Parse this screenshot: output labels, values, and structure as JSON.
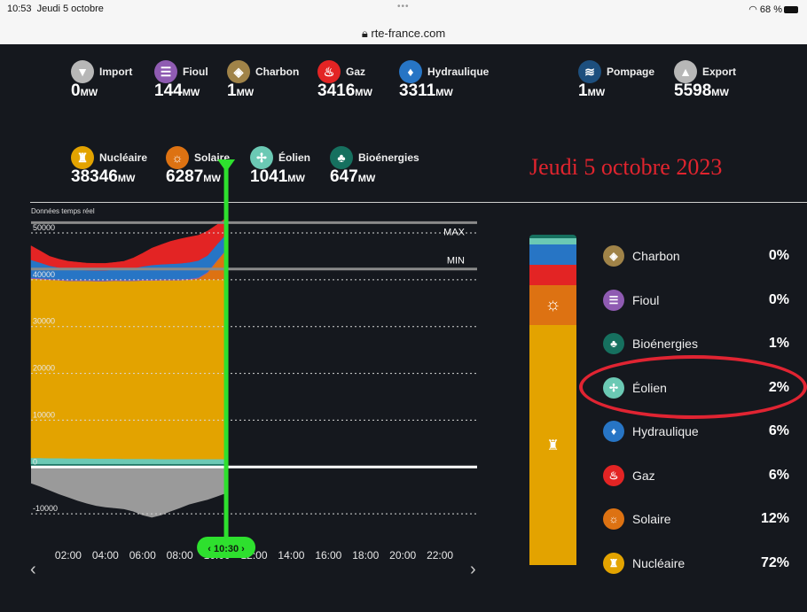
{
  "status_bar": {
    "time": "10:53",
    "date": "Jeudi 5 octobre",
    "url": "rte-france.com",
    "battery": "68 %"
  },
  "sources_top": [
    {
      "label": "Import",
      "value": "0",
      "unit": "MW",
      "icon": "chevron-down-icon",
      "color": "#b7b7b7"
    },
    {
      "label": "Fioul",
      "value": "144",
      "unit": "MW",
      "icon": "oil-barrel-icon",
      "color": "#8f5bb2"
    },
    {
      "label": "Charbon",
      "value": "1",
      "unit": "MW",
      "icon": "coal-icon",
      "color": "#a08348"
    },
    {
      "label": "Gaz",
      "value": "3416",
      "unit": "MW",
      "icon": "flame-icon",
      "color": "#e32424"
    },
    {
      "label": "Hydraulique",
      "value": "3311",
      "unit": "MW",
      "icon": "water-drop-icon",
      "color": "#2775c5"
    },
    {
      "label": "Pompage",
      "value": "1",
      "unit": "MW",
      "icon": "waves-icon",
      "color": "#1d4f7e"
    },
    {
      "label": "Export",
      "value": "5598",
      "unit": "MW",
      "icon": "chevron-up-icon",
      "color": "#b7b7b7"
    }
  ],
  "sources_bottom": [
    {
      "label": "Nucléaire",
      "value": "38346",
      "unit": "MW",
      "icon": "nuclear-plant-icon",
      "color": "#e3a300"
    },
    {
      "label": "Solaire",
      "value": "6287",
      "unit": "MW",
      "icon": "sun-icon",
      "color": "#dd7212"
    },
    {
      "label": "Éolien",
      "value": "1041",
      "unit": "MW",
      "icon": "wind-turbine-icon",
      "color": "#6bc9b4"
    },
    {
      "label": "Bioénergies",
      "value": "647",
      "unit": "MW",
      "icon": "sprout-icon",
      "color": "#16705f"
    }
  ],
  "date_title": "Jeudi 5 octobre 2023",
  "realtime_label": "Données temps réel",
  "chart_data": {
    "type": "area",
    "ylim": [
      -13000,
      57000
    ],
    "y_ticks": [
      -10000,
      0,
      10000,
      20000,
      30000,
      40000,
      50000
    ],
    "y_tick_labels": [
      "-10000",
      "0",
      "10000",
      "20000",
      "30000",
      "40000",
      "50000"
    ],
    "x_tick_labels": [
      "02:00",
      "04:00",
      "06:00",
      "08:00",
      "10:00",
      "12:00",
      "14:00",
      "16:00",
      "18:00",
      "20:00",
      "22:00"
    ],
    "x_ticks_hours": [
      2,
      4,
      6,
      8,
      10,
      12,
      14,
      16,
      18,
      20,
      22
    ],
    "x_range_hours": [
      0,
      24
    ],
    "max_line": {
      "label": "MAX",
      "value": 52200
    },
    "min_line": {
      "label": "MIN",
      "value": 42300
    },
    "cursor": {
      "label": "10:30",
      "hour": 10.5
    },
    "x_hours": [
      0,
      0.5,
      1,
      1.5,
      2,
      2.5,
      3,
      3.5,
      4,
      4.5,
      5,
      5.5,
      6,
      6.5,
      7,
      7.5,
      8,
      8.5,
      9,
      9.5,
      10,
      10.5
    ],
    "series": [
      {
        "name": "Bioénergies",
        "color": "#16705f",
        "values": [
          650,
          650,
          650,
          650,
          650,
          650,
          650,
          650,
          650,
          650,
          650,
          650,
          650,
          650,
          650,
          650,
          650,
          650,
          650,
          650,
          650,
          647
        ]
      },
      {
        "name": "Éolien",
        "color": "#6bc9b4",
        "values": [
          1300,
          1300,
          1250,
          1250,
          1200,
          1200,
          1200,
          1150,
          1150,
          1150,
          1100,
          1100,
          1100,
          1100,
          1050,
          1050,
          1050,
          1050,
          1050,
          1050,
          1050,
          1041
        ]
      },
      {
        "name": "Nucléaire",
        "color": "#e3a300",
        "values": [
          38300,
          38200,
          38100,
          38000,
          37900,
          37900,
          37900,
          37900,
          37900,
          38000,
          38000,
          38000,
          38100,
          38100,
          38200,
          38200,
          38200,
          38300,
          38300,
          38300,
          38300,
          38346
        ]
      },
      {
        "name": "Solaire",
        "color": "#dd7212",
        "values": [
          0,
          0,
          0,
          0,
          0,
          0,
          0,
          0,
          0,
          0,
          0,
          0,
          0,
          0,
          0,
          0,
          0,
          20,
          300,
          1500,
          4000,
          6287
        ]
      },
      {
        "name": "Charbon",
        "color": "#a08348",
        "values": [
          0,
          0,
          0,
          0,
          0,
          0,
          0,
          0,
          0,
          0,
          0,
          0,
          0,
          0,
          0,
          0,
          0,
          0,
          0,
          0,
          0,
          1
        ]
      },
      {
        "name": "Fioul",
        "color": "#8f5bb2",
        "values": [
          200,
          200,
          200,
          200,
          200,
          200,
          200,
          200,
          200,
          200,
          200,
          200,
          200,
          200,
          200,
          200,
          200,
          200,
          200,
          200,
          150,
          144
        ]
      },
      {
        "name": "Hydraulique",
        "color": "#2775c5",
        "values": [
          3800,
          3300,
          2800,
          2500,
          2300,
          2200,
          2100,
          2100,
          2100,
          2200,
          2300,
          2500,
          2800,
          3100,
          3200,
          3300,
          3400,
          3500,
          3600,
          3500,
          3400,
          3311
        ]
      },
      {
        "name": "Gaz",
        "color": "#e32424",
        "values": [
          3000,
          2500,
          2000,
          1800,
          1700,
          1600,
          1500,
          1500,
          1500,
          1500,
          1700,
          2200,
          2800,
          3600,
          4200,
          4800,
          5200,
          5400,
          5400,
          5200,
          4200,
          3416
        ]
      }
    ],
    "negative_series": {
      "name": "Export",
      "color": "#9a9a9a",
      "values": [
        -3500,
        -4200,
        -5000,
        -5800,
        -6500,
        -7200,
        -7800,
        -8300,
        -8600,
        -8800,
        -9000,
        -9500,
        -10300,
        -10800,
        -10300,
        -9500,
        -8800,
        -8000,
        -7500,
        -7000,
        -6300,
        -5598
      ]
    },
    "stacked_percentages": [
      {
        "name": "Charbon",
        "percent": 0,
        "label": "0%",
        "color": "#a08348",
        "icon": "coal-icon"
      },
      {
        "name": "Fioul",
        "percent": 0,
        "label": "0%",
        "color": "#8f5bb2",
        "icon": "oil-barrel-icon"
      },
      {
        "name": "Bioénergies",
        "percent": 1,
        "label": "1%",
        "color": "#16705f",
        "icon": "sprout-icon"
      },
      {
        "name": "Éolien",
        "percent": 2,
        "label": "2%",
        "color": "#6bc9b4",
        "icon": "wind-turbine-icon"
      },
      {
        "name": "Hydraulique",
        "percent": 6,
        "label": "6%",
        "color": "#2775c5",
        "icon": "water-drop-icon"
      },
      {
        "name": "Gaz",
        "percent": 6,
        "label": "6%",
        "color": "#e32424",
        "icon": "flame-icon"
      },
      {
        "name": "Solaire",
        "percent": 12,
        "label": "12%",
        "color": "#dd7212",
        "icon": "sun-icon"
      },
      {
        "name": "Nucléaire",
        "percent": 72,
        "label": "72%",
        "color": "#e3a300",
        "icon": "nuclear-plant-icon"
      }
    ]
  },
  "nav": {
    "prev": "‹",
    "next": "›"
  }
}
